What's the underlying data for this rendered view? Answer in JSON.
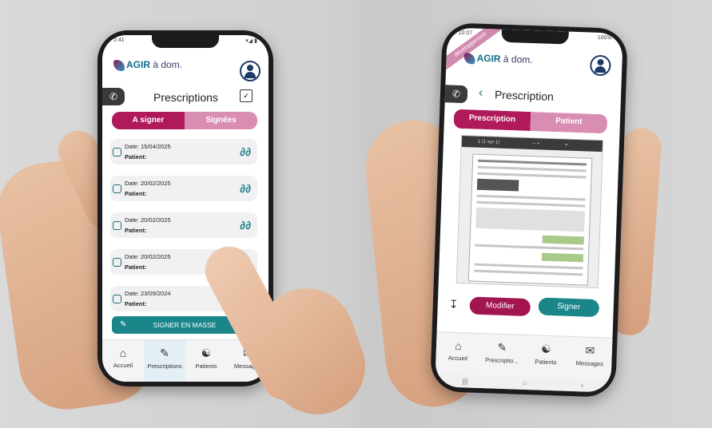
{
  "left": {
    "status_time": "2:41",
    "status_right": "▾◢ ▮",
    "logo_text_a": "AGIR",
    "logo_text_b": "à dom.",
    "title": "Prescriptions",
    "tab_a": "A signer",
    "tab_b": "Signées",
    "prescriptions": [
      {
        "date": "Date: 15/04/2025",
        "patient": "Patient:"
      },
      {
        "date": "Date: 20/02/2025",
        "patient": "Patient:"
      },
      {
        "date": "Date: 20/02/2025",
        "patient": "Patient:"
      },
      {
        "date": "Date: 20/02/2025",
        "patient": "Patient:"
      },
      {
        "date": "Date: 23/09/2024",
        "patient": "Patient:"
      }
    ],
    "bulk_label": "SIGNER EN MASSE",
    "nav": [
      "Accueil",
      "Prescriptions",
      "Patients",
      "Messages"
    ]
  },
  "right": {
    "status_time": "10:07",
    "status_right": "100%",
    "banner": "développement",
    "logo_text_a": "AGIR",
    "logo_text_b": "à dom.",
    "back": "‹",
    "title": "Prescription",
    "tab_a": "Prescription",
    "tab_b": "Patient",
    "doc_page": "1 (1 sur 1)",
    "modify_label": "Modifier",
    "sign_label": "Signer",
    "nav": [
      "Accueil",
      "Prescriptio...",
      "Patients",
      "Messages"
    ],
    "sysnav": [
      "|||",
      "○",
      "‹"
    ]
  },
  "colors": {
    "accent": "#b0195a",
    "accent_light": "#d98db2",
    "teal": "#1a868a"
  }
}
